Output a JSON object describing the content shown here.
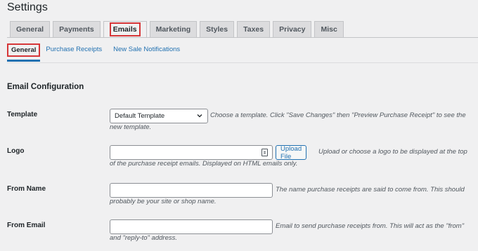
{
  "page": {
    "title": "Settings"
  },
  "tabs": [
    {
      "label": "General"
    },
    {
      "label": "Payments"
    },
    {
      "label": "Emails"
    },
    {
      "label": "Marketing"
    },
    {
      "label": "Styles"
    },
    {
      "label": "Taxes"
    },
    {
      "label": "Privacy"
    },
    {
      "label": "Misc"
    }
  ],
  "active_tab": "Emails",
  "subtabs": [
    {
      "label": "General"
    },
    {
      "label": "Purchase Receipts"
    },
    {
      "label": "New Sale Notifications"
    }
  ],
  "active_subtab": "General",
  "section": {
    "title": "Email Configuration"
  },
  "fields": {
    "template": {
      "label": "Template",
      "value": "Default Template",
      "desc_line1": "Choose a template. Click \"Save Changes\" then \"Preview Purchase Receipt\" to see the",
      "desc_line2": "new template."
    },
    "logo": {
      "label": "Logo",
      "value": "",
      "button": "Upload File",
      "desc_line1": "Upload or choose a logo to be displayed at the top",
      "desc_line2": "of the purchase receipt emails. Displayed on HTML emails only."
    },
    "from_name": {
      "label": "From Name",
      "value": "",
      "desc_line1": "The name purchase receipts are said to come from. This should",
      "desc_line2": "probably be your site or shop name."
    },
    "from_email": {
      "label": "From Email",
      "value": "",
      "desc_line1": "Email to send purchase receipts from. This will act as the \"from\"",
      "desc_line2": "and \"reply-to\" address."
    }
  },
  "colors": {
    "highlight": "#d63638",
    "link": "#2271b1",
    "background": "#f0f0f1"
  }
}
